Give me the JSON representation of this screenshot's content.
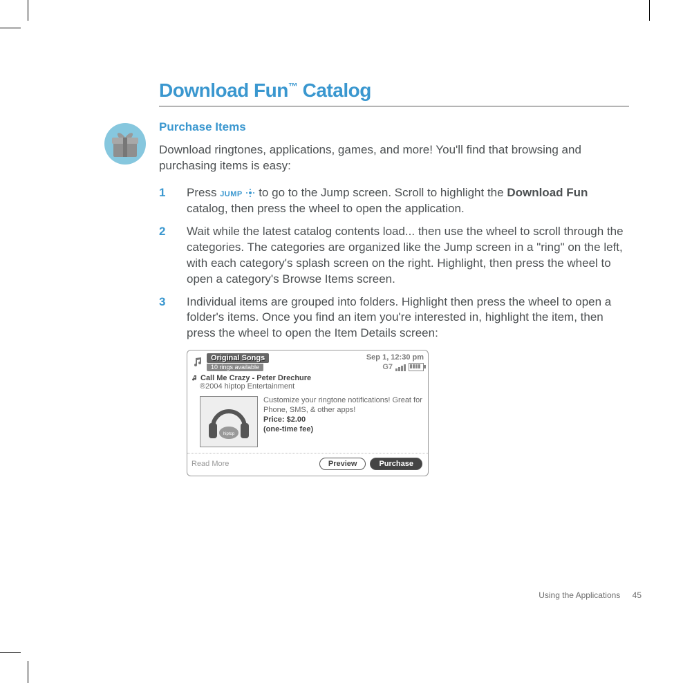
{
  "title_part1": "Download Fun",
  "title_tm": "™",
  "title_part2": " Catalog",
  "subhead": "Purchase Items",
  "intro": "Download ringtones, applications, games, and more! You'll find that browsing and purchasing items is easy:",
  "steps": {
    "s1": {
      "num": "1",
      "pre": "Press ",
      "jump": "JUMP",
      "post1": " to go to the Jump screen. Scroll to highlight the ",
      "bold": "Download Fun",
      "post2": " catalog, then press the wheel to open the application."
    },
    "s2": {
      "num": "2",
      "text": "Wait while the latest catalog contents load... then use the wheel to scroll through the categories. The categories are organized like the Jump screen in a \"ring\" on the left, with each category's splash screen on the right. Highlight, then press the wheel to open a category's Browse Items screen."
    },
    "s3": {
      "num": "3",
      "text": "Individual items are grouped into folders. Highlight then press the wheel to open a folder's items. Once you find an item you're interested in, highlight the item, then press the wheel to open the Item Details screen:"
    }
  },
  "device": {
    "category": "Original Songs",
    "avail": "10 rings available",
    "datetime": "Sep 1, 12:30 pm",
    "network": "G7",
    "item_title": "Call Me Crazy - Peter Drechure",
    "copyright": "®2004 hiptop Entertainment",
    "desc": "Customize your ringtone notifications! Great for Phone, SMS, & other apps!",
    "price": "Price: $2.00",
    "fee": "(one-time fee)",
    "readmore": "Read More",
    "preview": "Preview",
    "purchase": "Purchase"
  },
  "footer": {
    "section": "Using the Applications",
    "page": "45"
  }
}
